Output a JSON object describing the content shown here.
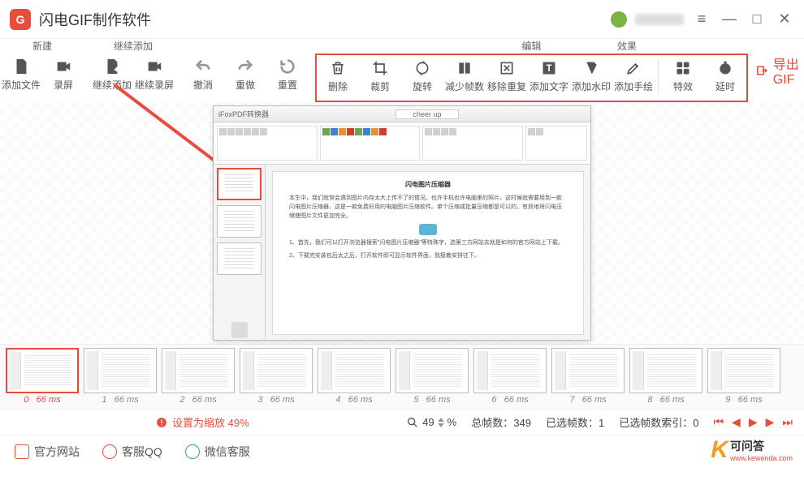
{
  "app": {
    "title": "闪电GIF制作软件",
    "logo_letter": "G"
  },
  "window_controls": {
    "menu": "≡",
    "minimize": "—",
    "maximize": "□",
    "close": "✕"
  },
  "toolbar": {
    "group_new": {
      "label": "新建",
      "add_file": "添加文件",
      "record": "录屏"
    },
    "group_append": {
      "label": "继续添加",
      "append_file": "继续添加",
      "append_record": "继续录屏"
    },
    "undo": "撤消",
    "redo": "重做",
    "reset": "重置",
    "group_edit": {
      "label": "编辑",
      "delete": "删除",
      "crop": "裁剪",
      "rotate": "旋转",
      "reduce_frames": "减少帧数",
      "remove_dup": "移除重复",
      "add_text": "添加文字",
      "add_watermark": "添加水印",
      "add_draw": "添加手绘"
    },
    "group_effect": {
      "label": "效果",
      "fx": "特效",
      "delay": "延时"
    },
    "export": "导出GIF"
  },
  "preview": {
    "window_title": "iFoxPDF转换器",
    "tab_hint": "cheer up",
    "doc_title": "闪电图片压缩器"
  },
  "frames": [
    {
      "index": 0,
      "duration": "66 ms",
      "selected": true
    },
    {
      "index": 1,
      "duration": "66 ms",
      "selected": false
    },
    {
      "index": 2,
      "duration": "66 ms",
      "selected": false
    },
    {
      "index": 3,
      "duration": "66 ms",
      "selected": false
    },
    {
      "index": 4,
      "duration": "66 ms",
      "selected": false
    },
    {
      "index": 5,
      "duration": "66 ms",
      "selected": false
    },
    {
      "index": 6,
      "duration": "66 ms",
      "selected": false
    },
    {
      "index": 7,
      "duration": "66 ms",
      "selected": false
    },
    {
      "index": 8,
      "duration": "66 ms",
      "selected": false
    },
    {
      "index": 9,
      "duration": "66 ms",
      "selected": false
    }
  ],
  "status": {
    "zoom_warn": "设置为缩放 49%",
    "zoom_value": "49",
    "zoom_unit": "%",
    "total_frames_label": "总帧数：",
    "total_frames": "349",
    "selected_frames_label": "已选帧数：",
    "selected_frames": "1",
    "selected_index_label": "已选帧数索引：",
    "selected_index": "0"
  },
  "footer": {
    "site": "官方网站",
    "qq": "客服QQ",
    "wechat": "微信客服",
    "wm_name": "可问答",
    "wm_url": "www.kewenda.com"
  }
}
